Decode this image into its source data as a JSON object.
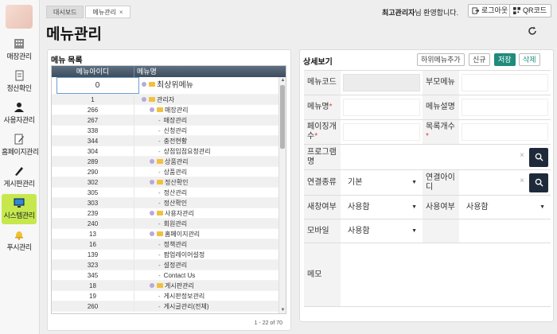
{
  "sidebar": {
    "items": [
      {
        "label": "매장관리",
        "icon": "store-icon"
      },
      {
        "label": "정산확인",
        "icon": "document-icon"
      },
      {
        "label": "사용자관리",
        "icon": "user-icon"
      },
      {
        "label": "홈페이지관리",
        "icon": "edit-page-icon"
      },
      {
        "label": "게시판관리",
        "icon": "pen-icon"
      },
      {
        "label": "시스템관리",
        "icon": "monitor-icon"
      },
      {
        "label": "푸시관리",
        "icon": "bell-icon"
      }
    ]
  },
  "header": {
    "tabs": [
      {
        "label": "대시보드"
      },
      {
        "label": "메뉴관리"
      }
    ],
    "welcome_name": "최고관리자",
    "welcome_suffix": "님 환영합니다.",
    "logout_label": "로그아웃",
    "qr_label": "QR코드",
    "page_title": "메뉴관리"
  },
  "menu_list": {
    "title": "메뉴 목록",
    "columns": [
      "메뉴아이디",
      "메뉴명"
    ],
    "rows": [
      {
        "id": "0",
        "name": "최상위메뉴",
        "level": 0,
        "type": "node"
      },
      {
        "id": "1",
        "name": "관리자",
        "level": 1,
        "type": "node"
      },
      {
        "id": "266",
        "name": "매장관리",
        "level": 2,
        "type": "node"
      },
      {
        "id": "267",
        "name": "매장관리",
        "level": 3,
        "type": "leaf"
      },
      {
        "id": "338",
        "name": "신청관리",
        "level": 3,
        "type": "leaf"
      },
      {
        "id": "344",
        "name": "충전현황",
        "level": 3,
        "type": "leaf"
      },
      {
        "id": "304",
        "name": "상점입점요청관리",
        "level": 3,
        "type": "leaf"
      },
      {
        "id": "289",
        "name": "상품관리",
        "level": 2,
        "type": "node"
      },
      {
        "id": "290",
        "name": "상품관리",
        "level": 3,
        "type": "leaf"
      },
      {
        "id": "302",
        "name": "정산확인",
        "level": 2,
        "type": "node"
      },
      {
        "id": "305",
        "name": "정산관리",
        "level": 3,
        "type": "leaf"
      },
      {
        "id": "303",
        "name": "정산확인",
        "level": 3,
        "type": "leaf"
      },
      {
        "id": "239",
        "name": "사용자관리",
        "level": 2,
        "type": "node"
      },
      {
        "id": "240",
        "name": "회원관리",
        "level": 3,
        "type": "leaf"
      },
      {
        "id": "13",
        "name": "홈페이지관리",
        "level": 2,
        "type": "node"
      },
      {
        "id": "16",
        "name": "정책관리",
        "level": 3,
        "type": "leaf"
      },
      {
        "id": "139",
        "name": "팝업레이어설정",
        "level": 3,
        "type": "leaf"
      },
      {
        "id": "323",
        "name": "설정관리",
        "level": 3,
        "type": "leaf"
      },
      {
        "id": "345",
        "name": "Contact Us",
        "level": 3,
        "type": "leaf"
      },
      {
        "id": "18",
        "name": "게시판관리",
        "level": 2,
        "type": "node"
      },
      {
        "id": "19",
        "name": "게시판정보관리",
        "level": 3,
        "type": "leaf"
      },
      {
        "id": "260",
        "name": "게시글관리(전체)",
        "level": 3,
        "type": "leaf"
      }
    ],
    "pager": "1 - 22 of 70"
  },
  "detail": {
    "title": "상세보기",
    "buttons": {
      "add_sub": "하위메뉴추가",
      "new": "신규",
      "save": "저장",
      "delete": "삭제"
    },
    "fields": {
      "menu_code": "메뉴코드",
      "parent_menu": "부모메뉴",
      "menu_name": "메뉴명",
      "menu_desc": "메뉴설명",
      "paging_count": "페이징개수",
      "list_count": "목록개수",
      "program_name": "프로그램명",
      "link_type": "연결종류",
      "link_type_value": "기본",
      "link_id": "연결아이디",
      "new_window": "새창여부",
      "new_window_value": "사용함",
      "use_yn": "사용여부",
      "use_yn_value": "사용함",
      "mobile": "모바일",
      "mobile_value": "사용함",
      "memo": "메모"
    }
  },
  "colors": {
    "accent": "#1f8b7c",
    "sidebar_active": "#c6e84d",
    "grid_header": "#4a5a6a",
    "search_button": "#1e2a3a"
  }
}
